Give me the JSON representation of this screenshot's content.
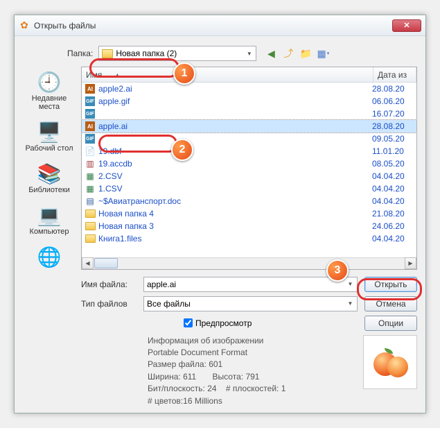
{
  "window": {
    "title": "Открыть файлы"
  },
  "folder": {
    "label": "Папка:",
    "current": "Новая папка (2)"
  },
  "columns": {
    "name": "Имя",
    "date": "Дата из"
  },
  "files": [
    {
      "icon": "ai",
      "name": "apple2.ai",
      "date": "28.08.20"
    },
    {
      "icon": "gif",
      "name": "apple.gif",
      "date": "06.06.20"
    },
    {
      "icon": "gif",
      "name": "",
      "date": "16.07.20"
    },
    {
      "icon": "ai",
      "name": "apple.ai",
      "date": "28.08.20",
      "selected": true
    },
    {
      "icon": "gif",
      "name": "",
      "date": "09.05.20"
    },
    {
      "icon": "dbf",
      "name": "19.dbf",
      "date": "11.01.20"
    },
    {
      "icon": "accdb",
      "name": "19.accdb",
      "date": "08.05.20"
    },
    {
      "icon": "csv",
      "name": "2.CSV",
      "date": "04.04.20"
    },
    {
      "icon": "csv",
      "name": "1.CSV",
      "date": "04.04.20"
    },
    {
      "icon": "doc",
      "name": "~$Авиатранспорт.doc",
      "date": "04.04.20"
    },
    {
      "icon": "folder",
      "name": "Новая папка 4",
      "date": "21.08.20"
    },
    {
      "icon": "folder",
      "name": "Новая папка 3",
      "date": "24.06.20"
    },
    {
      "icon": "folder",
      "name": "Книга1.files",
      "date": "04.04.20"
    }
  ],
  "places": [
    {
      "label": "Недавние места"
    },
    {
      "label": "Рабочий стол"
    },
    {
      "label": "Библиотеки"
    },
    {
      "label": "Компьютер"
    },
    {
      "label": ""
    }
  ],
  "filename": {
    "label": "Имя файла:",
    "value": "apple.ai"
  },
  "filetype": {
    "label": "Тип файлов",
    "value": "Все файлы"
  },
  "buttons": {
    "open": "Открыть",
    "cancel": "Отмена",
    "options": "Опции"
  },
  "preview": {
    "checkbox": "Предпросмотр",
    "checked": true
  },
  "info": {
    "title": "Информация об изображении",
    "format": "Portable Document Format",
    "size_label": "Размер файла:",
    "size": "601",
    "width_label": "Ширина:",
    "width": "611",
    "height_label": "Высота:",
    "height": "791",
    "bpp_label": "Бит/плоскость:",
    "bpp": "24",
    "planes_label": "# плоскостей:",
    "planes": "1",
    "colors_label": "# цветов:",
    "colors": "16 Millions"
  },
  "callouts": {
    "c1": "1",
    "c2": "2",
    "c3": "3"
  }
}
